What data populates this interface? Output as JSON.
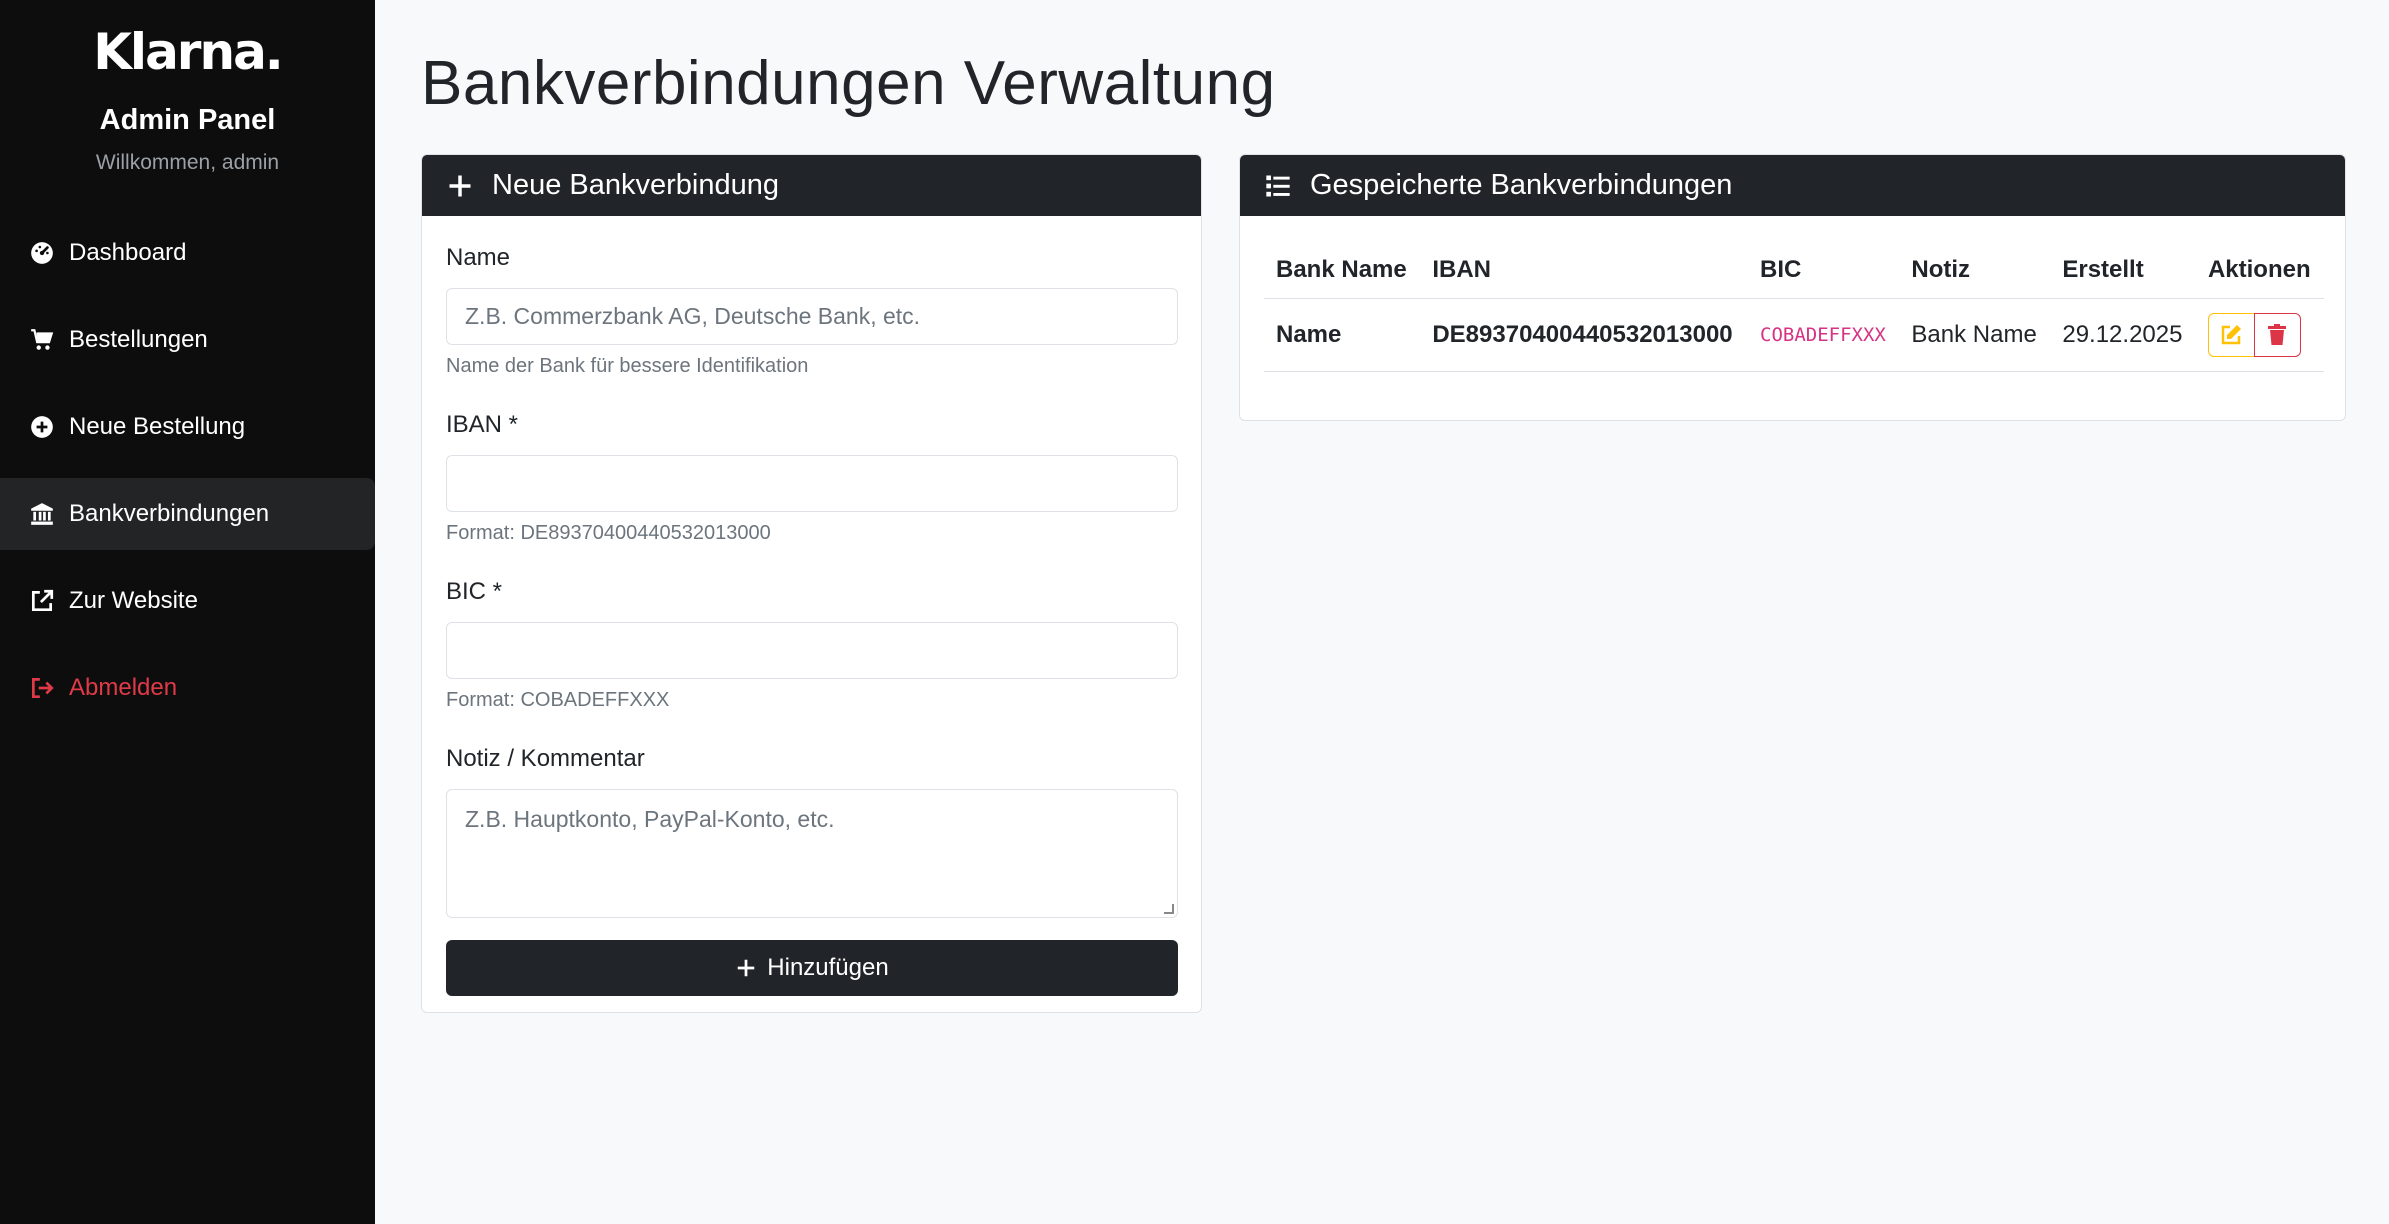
{
  "sidebar": {
    "logo": "Klarna.",
    "title": "Admin Panel",
    "welcome": "Willkommen, admin",
    "items": [
      {
        "label": "Dashboard",
        "icon": "dashboard-icon"
      },
      {
        "label": "Bestellungen",
        "icon": "cart-icon"
      },
      {
        "label": "Neue Bestellung",
        "icon": "plus-circle-icon"
      },
      {
        "label": "Bankverbindungen",
        "icon": "bank-icon",
        "active": true
      },
      {
        "label": "Zur Website",
        "icon": "external-link-icon"
      },
      {
        "label": "Abmelden",
        "icon": "logout-icon"
      }
    ]
  },
  "page": {
    "title": "Bankverbindungen Verwaltung"
  },
  "form": {
    "header": "Neue Bankverbindung",
    "name_label": "Name",
    "name_placeholder": "Z.B. Commerzbank AG, Deutsche Bank, etc.",
    "name_help": "Name der Bank für bessere Identifikation",
    "iban_label": "IBAN *",
    "iban_value": "",
    "iban_help": "Format: DE89370400440532013000",
    "bic_label": "BIC *",
    "bic_value": "",
    "bic_help": "Format: COBADEFFXXX",
    "note_label": "Notiz / Kommentar",
    "note_placeholder": "Z.B. Hauptkonto, PayPal-Konto, etc.",
    "submit_label": "Hinzufügen"
  },
  "list": {
    "header": "Gespeicherte Bankverbindungen",
    "columns": [
      "Bank Name",
      "IBAN",
      "BIC",
      "Notiz",
      "Erstellt",
      "Aktionen"
    ],
    "rows": [
      {
        "name": "Name",
        "iban": "DE89370400440532013000",
        "bic": "COBADEFFXXX",
        "note": "Bank Name",
        "created": "29.12.2025"
      }
    ]
  },
  "colors": {
    "sidebar_bg": "#0d0d0d",
    "header_bg": "#212529",
    "danger": "#dc3545",
    "warning": "#ffc107",
    "code": "#d63384"
  }
}
